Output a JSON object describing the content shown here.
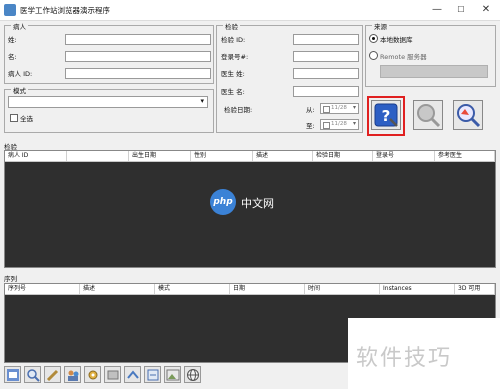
{
  "window": {
    "title": "医学工作站浏览器演示程序",
    "minimize": "—",
    "maximize": "☐",
    "close": "✕"
  },
  "patient": {
    "group_label": "病人",
    "surname_label": "姓:",
    "given_label": "名:",
    "id_label": "病人 ID:"
  },
  "modality": {
    "group_label": "模式",
    "select_all_label": "全选"
  },
  "study": {
    "group_label": "检验",
    "study_id_label": "检验 ID:",
    "accession_label": "登录号#:",
    "doctor_surname_label": "医生 姓:",
    "doctor_given_label": "医生 名:",
    "date_label": "检验日期:",
    "from_label": "从:",
    "to_label": "至:",
    "from_date": "11/28",
    "to_date": "11/28"
  },
  "source": {
    "group_label": "来源",
    "local_db_label": "本地数据库",
    "remote_label": "Remote 服务器",
    "local_selected": true
  },
  "studies_table": {
    "label": "检验",
    "columns": [
      "病人 ID",
      "",
      "出生日期",
      "性别",
      "描述",
      "检验日期",
      "登录号",
      "参考医生"
    ]
  },
  "series_table": {
    "label": "序列",
    "columns": [
      "序列号",
      "描述",
      "模式",
      "日期",
      "时间",
      "Instances",
      "3D 可用"
    ]
  },
  "watermarks": {
    "center": "中文网",
    "center_logo": "php",
    "corner": "软件技巧"
  },
  "colors": {
    "highlight_border": "#e02020",
    "query_button": "#2d5fc4",
    "dark_panel": "#2f2f2f"
  }
}
